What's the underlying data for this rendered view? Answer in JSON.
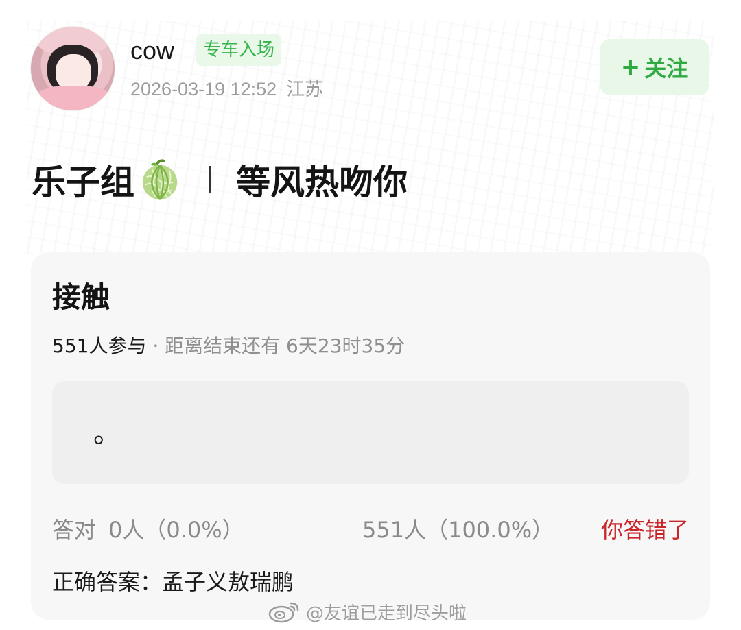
{
  "post": {
    "username": "cow",
    "tag": "专车入场",
    "timestamp": "2026-03-19 12:52",
    "location": "江苏",
    "follow_label": "关注",
    "follow_icon": "plus-icon",
    "title_left": "乐子组",
    "title_emoji": "melon-icon",
    "title_right": "等风热吻你"
  },
  "quiz": {
    "question": "接触",
    "participants": "551人参与",
    "separator": " · ",
    "time_left": "距离结束还有 6天23时35分",
    "option_text": "。",
    "correct_label": "答对",
    "correct_stat": "0人（0.0%）",
    "wrong_stat": "551人（100.0%）",
    "verdict": "你答错了",
    "answer_label": "正确答案：",
    "answer_value": "孟子义敖瑞鹏"
  },
  "watermark": {
    "text": "@友谊已走到尽头啦",
    "icon": "weibo-logo-icon"
  },
  "colors": {
    "accent_green": "#36b34a",
    "tag_bg": "#eaf8ea",
    "wrong_red": "#c8262b",
    "card_bg": "#f7f7f7",
    "option_bg": "#efefef",
    "muted_text": "#8a8a8a"
  }
}
